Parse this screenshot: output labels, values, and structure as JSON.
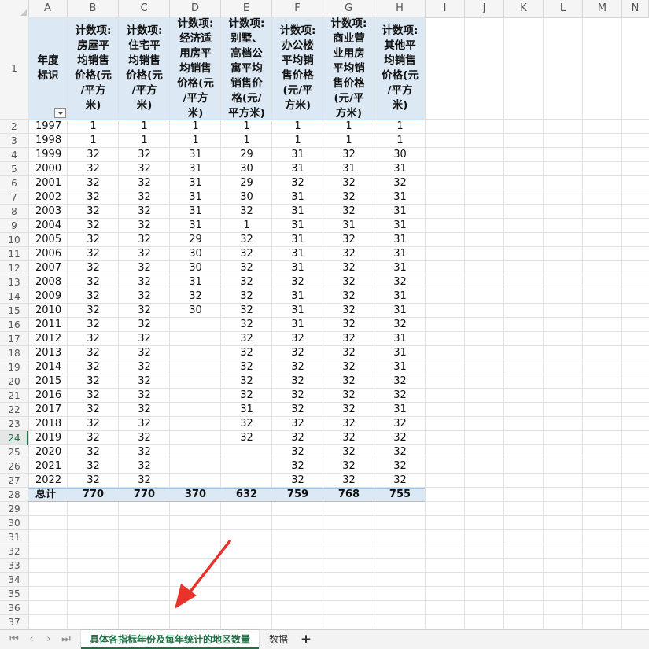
{
  "columns": [
    "A",
    "B",
    "C",
    "D",
    "E",
    "F",
    "G",
    "H",
    "I",
    "J",
    "K",
    "L",
    "M",
    "N"
  ],
  "headers": [
    "年度\n标识",
    "计数项:\n房屋平\n均销售\n价格(元\n/平方\n米)",
    "计数项:\n住宅平\n均销售\n价格(元\n/平方\n米)",
    "计数项:\n经济适\n用房平\n均销售\n价格(元\n/平方\n米)",
    "计数项:\n别墅、\n高档公\n寓平均\n销售价\n格(元/\n平方米)",
    "计数项:\n办公楼\n平均销\n售价格\n(元/平\n方米)",
    "计数项:\n商业营\n业用房\n平均销\n售价格\n(元/平\n方米)",
    "计数项:\n其他平\n均销售\n价格(元\n/平方\n米)"
  ],
  "rows": [
    [
      "1997",
      "1",
      "1",
      "1",
      "1",
      "1",
      "1",
      "1"
    ],
    [
      "1998",
      "1",
      "1",
      "1",
      "1",
      "1",
      "1",
      "1"
    ],
    [
      "1999",
      "32",
      "32",
      "31",
      "29",
      "31",
      "32",
      "30"
    ],
    [
      "2000",
      "32",
      "32",
      "31",
      "30",
      "31",
      "31",
      "31"
    ],
    [
      "2001",
      "32",
      "32",
      "31",
      "29",
      "32",
      "32",
      "32"
    ],
    [
      "2002",
      "32",
      "32",
      "31",
      "30",
      "31",
      "32",
      "31"
    ],
    [
      "2003",
      "32",
      "32",
      "31",
      "32",
      "31",
      "32",
      "31"
    ],
    [
      "2004",
      "32",
      "32",
      "31",
      "1",
      "31",
      "31",
      "31"
    ],
    [
      "2005",
      "32",
      "32",
      "29",
      "32",
      "31",
      "32",
      "31"
    ],
    [
      "2006",
      "32",
      "32",
      "30",
      "32",
      "31",
      "32",
      "31"
    ],
    [
      "2007",
      "32",
      "32",
      "30",
      "32",
      "31",
      "32",
      "31"
    ],
    [
      "2008",
      "32",
      "32",
      "31",
      "32",
      "32",
      "32",
      "32"
    ],
    [
      "2009",
      "32",
      "32",
      "32",
      "32",
      "31",
      "32",
      "31"
    ],
    [
      "2010",
      "32",
      "32",
      "30",
      "32",
      "31",
      "32",
      "31"
    ],
    [
      "2011",
      "32",
      "32",
      "",
      "32",
      "31",
      "32",
      "32"
    ],
    [
      "2012",
      "32",
      "32",
      "",
      "32",
      "32",
      "32",
      "31"
    ],
    [
      "2013",
      "32",
      "32",
      "",
      "32",
      "32",
      "32",
      "31"
    ],
    [
      "2014",
      "32",
      "32",
      "",
      "32",
      "32",
      "32",
      "31"
    ],
    [
      "2015",
      "32",
      "32",
      "",
      "32",
      "32",
      "32",
      "32"
    ],
    [
      "2016",
      "32",
      "32",
      "",
      "32",
      "32",
      "32",
      "32"
    ],
    [
      "2017",
      "32",
      "32",
      "",
      "31",
      "32",
      "32",
      "31"
    ],
    [
      "2018",
      "32",
      "32",
      "",
      "32",
      "32",
      "32",
      "32"
    ],
    [
      "2019",
      "32",
      "32",
      "",
      "32",
      "32",
      "32",
      "32"
    ],
    [
      "2020",
      "32",
      "32",
      "",
      "",
      "32",
      "32",
      "32"
    ],
    [
      "2021",
      "32",
      "32",
      "",
      "",
      "32",
      "32",
      "32"
    ],
    [
      "2022",
      "32",
      "32",
      "",
      "",
      "32",
      "32",
      "32"
    ]
  ],
  "total_row": [
    "总计",
    "770",
    "770",
    "370",
    "632",
    "759",
    "768",
    "755"
  ],
  "row_numbers": [
    "1",
    "2",
    "3",
    "4",
    "5",
    "6",
    "7",
    "8",
    "9",
    "10",
    "11",
    "12",
    "13",
    "14",
    "15",
    "16",
    "17",
    "18",
    "19",
    "20",
    "21",
    "22",
    "23",
    "24",
    "25",
    "26",
    "27",
    "28",
    "29",
    "30",
    "31",
    "32",
    "33",
    "34",
    "35",
    "36",
    "37"
  ],
  "active_row": "24",
  "sheet_tabs": [
    "具体各指标年份及每年统计的地区数量",
    "数据"
  ],
  "add_tab_label": "+",
  "nav_buttons": [
    "⏮",
    "‹",
    "›",
    "⏭"
  ],
  "colors": {
    "accent": "#1e7145",
    "pivot_band": "#dce9f5",
    "annotation_arrow": "#e8332a"
  },
  "icons": [
    "filter-dropdown-icon",
    "annotation-arrow-icon"
  ]
}
